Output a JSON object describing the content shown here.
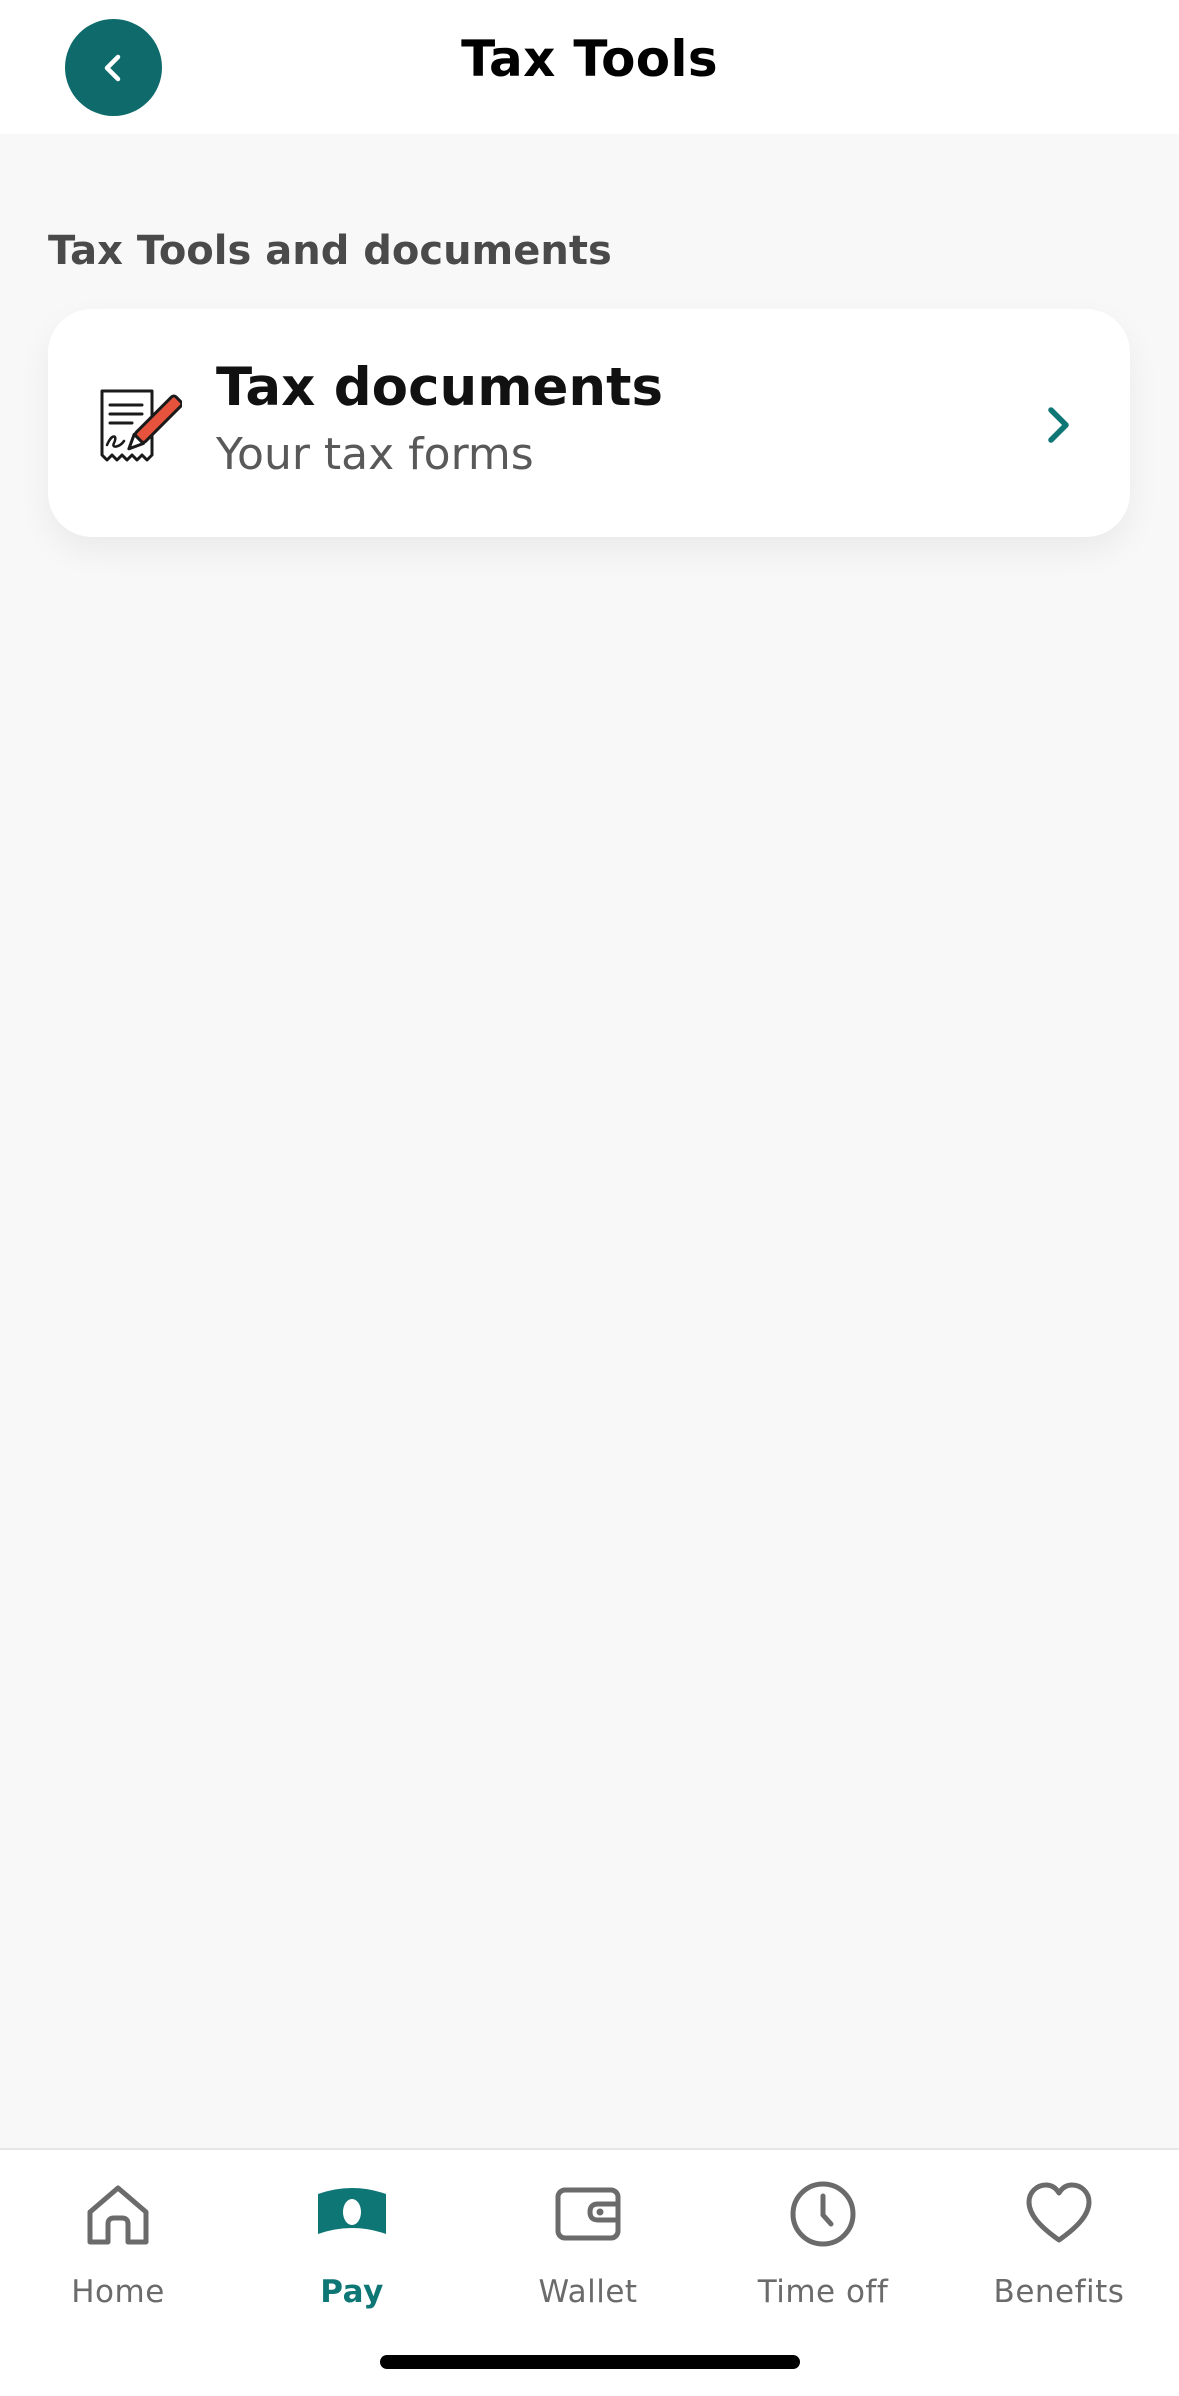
{
  "header": {
    "title": "Tax Tools",
    "back_icon": "chevron-left-icon"
  },
  "section": {
    "title": "Tax Tools and documents"
  },
  "card": {
    "title": "Tax documents",
    "subtitle": "Your tax forms",
    "icon": "signed-document-icon",
    "chevron": "chevron-right-icon"
  },
  "tabbar": {
    "items": [
      {
        "label": "Home",
        "icon": "home-icon"
      },
      {
        "label": "Pay",
        "icon": "money-icon",
        "active": true
      },
      {
        "label": "Wallet",
        "icon": "wallet-icon"
      },
      {
        "label": "Time off",
        "icon": "clock-icon"
      },
      {
        "label": "Benefits",
        "icon": "heart-icon"
      }
    ]
  },
  "colors": {
    "accent": "#0f6b6b",
    "active_tab": "#0f7676",
    "background": "#f8f8f8",
    "inactive_tab": "#6b6b6b",
    "pen": "#e5533d"
  }
}
